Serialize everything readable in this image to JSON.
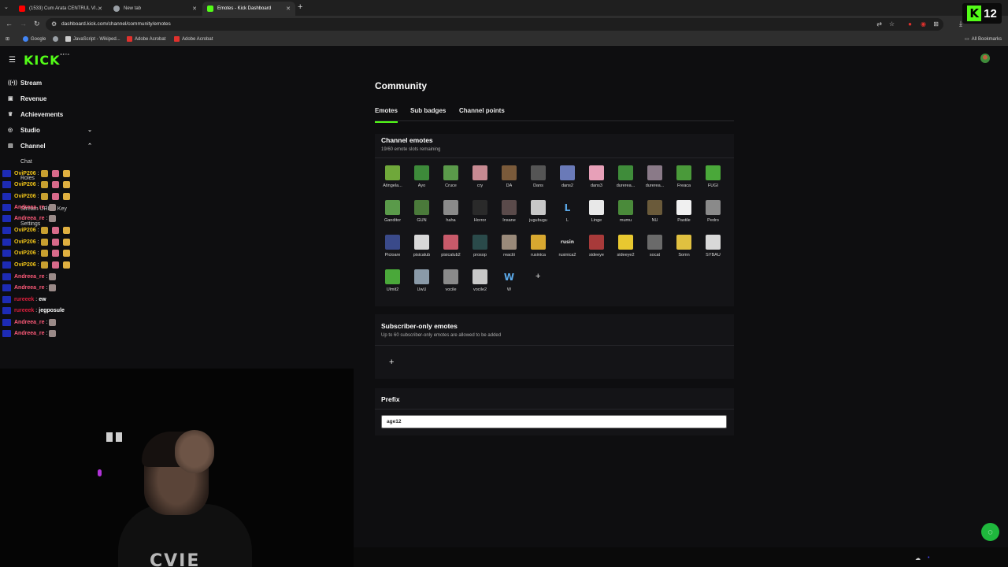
{
  "browser": {
    "tabs": [
      {
        "title": "(1533) Cum Arata CENTRUL VI...",
        "icon": "youtube-icon",
        "color": "#ff0000"
      },
      {
        "title": "New tab",
        "icon": "chrome-icon",
        "color": "#9aa0a6"
      },
      {
        "title": "Emotes - Kick Dashboard",
        "icon": "kick-icon",
        "color": "#53fc18"
      }
    ],
    "url": "dashboard.kick.com/channel/community/emotes",
    "bookmarks": [
      {
        "label": "Google",
        "color": "#4285f4"
      },
      {
        "label": "",
        "color": "#9aa0a6"
      },
      {
        "label": "JavaScript - Wikiped...",
        "color": "#cccccc"
      },
      {
        "label": "Adobe Acrobat",
        "color": "#e0312d"
      },
      {
        "label": "Adobe Acrobat",
        "color": "#e0312d"
      }
    ],
    "all_bookmarks": "All Bookmarks",
    "overlay_badge": "12"
  },
  "app": {
    "logo": "KICK",
    "logo_tag": "BETA"
  },
  "sidebar": {
    "items": [
      {
        "label": "Stream",
        "icon": "stream-icon"
      },
      {
        "label": "Revenue",
        "icon": "revenue-icon"
      },
      {
        "label": "Achievements",
        "icon": "trophy-icon"
      },
      {
        "label": "Studio",
        "icon": "studio-icon"
      },
      {
        "label": "Channel",
        "icon": "channel-icon"
      }
    ],
    "sub_items": [
      "Chat",
      "Roles",
      "Stream URL & Key",
      "Settings"
    ]
  },
  "chat": [
    {
      "user": "OviP206",
      "color": "#f0c419",
      "msg": "",
      "emotes": 3
    },
    {
      "user": "OviP206",
      "color": "#f0c419",
      "msg": "",
      "emotes": 3
    },
    {
      "user": "OviP206",
      "color": "#f0c419",
      "msg": "",
      "emotes": 3
    },
    {
      "user": "Andreea_re",
      "color": "#ff5b7a",
      "msg": "",
      "emotes": 1
    },
    {
      "user": "Andreea_re",
      "color": "#ff5b7a",
      "msg": "",
      "emotes": 1
    },
    {
      "user": "OviP206",
      "color": "#f0c419",
      "msg": "",
      "emotes": 3
    },
    {
      "user": "OviP206",
      "color": "#f0c419",
      "msg": "",
      "emotes": 3
    },
    {
      "user": "OviP206",
      "color": "#f0c419",
      "msg": "",
      "emotes": 3
    },
    {
      "user": "OviP206",
      "color": "#f0c419",
      "msg": "",
      "emotes": 3
    },
    {
      "user": "Andreea_re",
      "color": "#ff5b7a",
      "msg": "",
      "emotes": 1
    },
    {
      "user": "Andreea_re",
      "color": "#ff5b7a",
      "msg": "",
      "emotes": 1
    },
    {
      "user": "rureeek",
      "color": "#e01f3d",
      "msg": "ew",
      "emotes": 0
    },
    {
      "user": "rureeek",
      "color": "#e01f3d",
      "msg": "jegposule",
      "emotes": 0
    },
    {
      "user": "Andreea_re",
      "color": "#ff5b7a",
      "msg": "",
      "emotes": 1
    },
    {
      "user": "Andreea_re",
      "color": "#ff5b7a",
      "msg": "",
      "emotes": 1
    }
  ],
  "webcam": {
    "shirt_text": "CVIE"
  },
  "main": {
    "title": "Community",
    "tabs": [
      "Emotes",
      "Sub badges",
      "Channel points"
    ],
    "channel_emotes": {
      "title": "Channel emotes",
      "subtitle": "19/60 emote slots remaining",
      "emotes": [
        {
          "name": "Atingela...",
          "color": "#6fa83a"
        },
        {
          "name": "Ayo",
          "color": "#3d8a3a"
        },
        {
          "name": "Cruce",
          "color": "#5a9a4a"
        },
        {
          "name": "cry",
          "color": "#c78a92"
        },
        {
          "name": "DA",
          "color": "#7a5a3a"
        },
        {
          "name": "Dans",
          "color": "#555555"
        },
        {
          "name": "dans2",
          "color": "#6a7ab8"
        },
        {
          "name": "dans3",
          "color": "#e7a0b8"
        },
        {
          "name": "durerea...",
          "color": "#3f8c3a"
        },
        {
          "name": "durerea...",
          "color": "#8a7a88"
        },
        {
          "name": "Freaca",
          "color": "#4a9a3a"
        },
        {
          "name": "FUGI",
          "color": "#4aa83a"
        },
        {
          "name": "Ganditor",
          "color": "#5a9a4a"
        },
        {
          "name": "GUN",
          "color": "#4a7a3a"
        },
        {
          "name": "haha",
          "color": "#8a8a8a"
        },
        {
          "name": "Horror",
          "color": "#2a2a2a"
        },
        {
          "name": "Insane",
          "color": "#5a4a4a"
        },
        {
          "name": "jugubugu",
          "color": "#c8c8c8"
        },
        {
          "name": "L",
          "color": "#5aa8e8"
        },
        {
          "name": "Linge",
          "color": "#e8e8e8"
        },
        {
          "name": "mumu",
          "color": "#4a8a3a"
        },
        {
          "name": "NU",
          "color": "#6a5a3a"
        },
        {
          "name": "Pastile",
          "color": "#f0f0f0"
        },
        {
          "name": "Pedro",
          "color": "#8a8a8a"
        },
        {
          "name": "Picioare",
          "color": "#3a4a8a"
        },
        {
          "name": "pisicalub",
          "color": "#d8d8d8"
        },
        {
          "name": "pisicalub2",
          "color": "#c85a6a"
        },
        {
          "name": "prosop",
          "color": "#2a4a4a"
        },
        {
          "name": "reactii",
          "color": "#9a8a7a"
        },
        {
          "name": "rusinica",
          "color": "#d8a830"
        },
        {
          "name": "rusinica2",
          "color": "#888888"
        },
        {
          "name": "sideeye",
          "color": "#a83a3a"
        },
        {
          "name": "sideeye2",
          "color": "#e8c830"
        },
        {
          "name": "socat",
          "color": "#6a6a6a"
        },
        {
          "name": "Somn",
          "color": "#e0c040"
        },
        {
          "name": "SYBAU",
          "color": "#d8d8d8"
        },
        {
          "name": "Ulmit2",
          "color": "#4aa83a"
        },
        {
          "name": "UwU",
          "color": "#8a9aa8"
        },
        {
          "name": "vocile",
          "color": "#8a8a8a"
        },
        {
          "name": "vocile2",
          "color": "#c8c8c8"
        },
        {
          "name": "W",
          "color": "#5aa8e8"
        }
      ],
      "emote_letters": {
        "18": "L",
        "40": "W",
        "30": "rusin"
      },
      "add_label": "+"
    },
    "subscriber_emotes": {
      "title": "Subscriber-only emotes",
      "subtitle": "Up to 60 subscriber-only emotes are allowed to be added",
      "add_label": "+"
    },
    "prefix": {
      "title": "Prefix",
      "value": "age12"
    }
  },
  "colors": {
    "accent": "#53fc18",
    "background": "#0e0e10",
    "card": "#141417"
  }
}
